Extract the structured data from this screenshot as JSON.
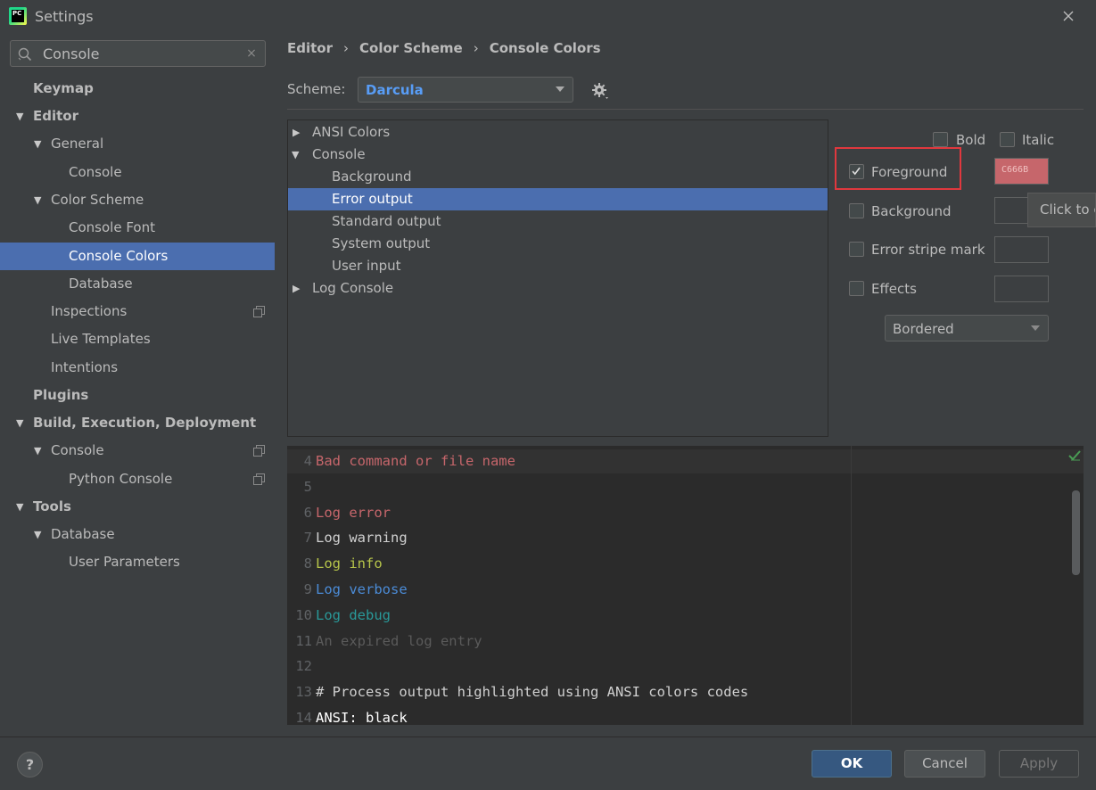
{
  "window": {
    "title": "Settings",
    "logo_text": "PC"
  },
  "search": {
    "value": "Console",
    "clear_label": "×"
  },
  "sidebar": {
    "items": [
      {
        "label": "Keymap"
      },
      {
        "label": "Editor"
      },
      {
        "label": "General"
      },
      {
        "label": "Console"
      },
      {
        "label": "Color Scheme"
      },
      {
        "label": "Console Font"
      },
      {
        "label": "Console Colors"
      },
      {
        "label": "Database"
      },
      {
        "label": "Inspections"
      },
      {
        "label": "Live Templates"
      },
      {
        "label": "Intentions"
      },
      {
        "label": "Plugins"
      },
      {
        "label": "Build, Execution, Deployment"
      },
      {
        "label": "Console"
      },
      {
        "label": "Python Console"
      },
      {
        "label": "Tools"
      },
      {
        "label": "Database"
      },
      {
        "label": "User Parameters"
      }
    ]
  },
  "breadcrumb": {
    "items": [
      "Editor",
      "Color Scheme",
      "Console Colors"
    ],
    "separator": "›"
  },
  "scheme": {
    "label": "Scheme:",
    "value": "Darcula"
  },
  "attributes": {
    "items": [
      {
        "label": "ANSI Colors"
      },
      {
        "label": "Console"
      },
      {
        "label": "Background"
      },
      {
        "label": "Error output"
      },
      {
        "label": "Standard output"
      },
      {
        "label": "System output"
      },
      {
        "label": "User input"
      },
      {
        "label": "Log Console"
      }
    ]
  },
  "options": {
    "bold_label": "Bold",
    "italic_label": "Italic",
    "foreground_label": "Foreground",
    "foreground_checked": true,
    "foreground_color": "C666B",
    "foreground_hex": "#c6666b",
    "background_label": "Background",
    "error_stripe_label": "Error stripe mark",
    "effects_label": "Effects",
    "effects_value": "Bordered",
    "tooltip": "Click to c"
  },
  "preview": {
    "lines": [
      {
        "num": "4",
        "text": "Bad command or file name",
        "color": "#c6666b"
      },
      {
        "num": "5",
        "text": "",
        "color": "#a9b7c6"
      },
      {
        "num": "6",
        "text": "Log error",
        "color": "#c6666b"
      },
      {
        "num": "7",
        "text": "Log warning",
        "color": "#d0d0d0"
      },
      {
        "num": "8",
        "text": "Log info",
        "color": "#b6c44a"
      },
      {
        "num": "9",
        "text": "Log verbose",
        "color": "#4b8bd6"
      },
      {
        "num": "10",
        "text": "Log debug",
        "color": "#299999"
      },
      {
        "num": "11",
        "text": "An expired log entry",
        "color": "#5a5a5a"
      },
      {
        "num": "12",
        "text": "",
        "color": "#a9b7c6"
      },
      {
        "num": "13",
        "text": "# Process output highlighted using ANSI colors codes",
        "color": "#d0d0d0"
      },
      {
        "num": "14",
        "text": "ANSI: black",
        "color": "#ffffff"
      }
    ]
  },
  "footer": {
    "help_label": "?",
    "ok_label": "OK",
    "cancel_label": "Cancel",
    "apply_label": "Apply"
  }
}
